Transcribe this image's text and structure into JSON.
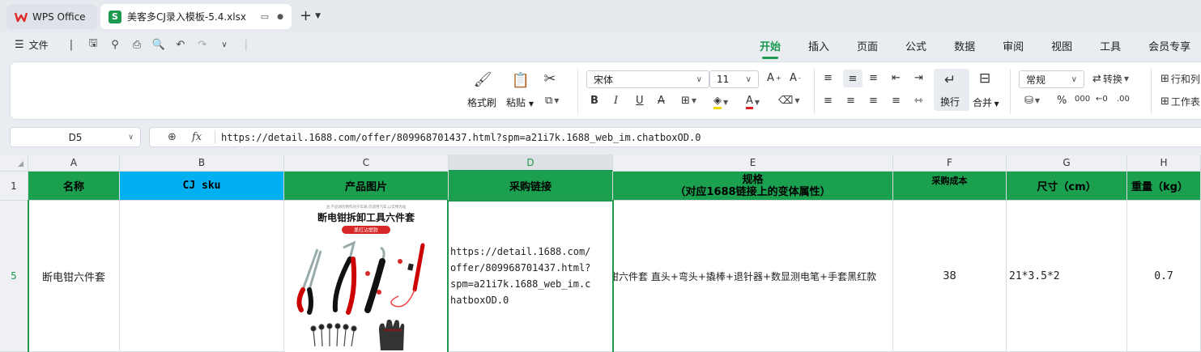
{
  "tabs": {
    "home": "WPS Office",
    "file": "美客多CJ录入模板-5.4.xlsx",
    "file_badge": "S"
  },
  "menu": {
    "file_label": "文件",
    "ribbon_tabs": [
      "开始",
      "插入",
      "页面",
      "公式",
      "数据",
      "审阅",
      "视图",
      "工具",
      "会员专享"
    ]
  },
  "ribbon": {
    "format_painter": "格式刷",
    "paste": "粘贴",
    "font_name": "宋体",
    "font_size": "11",
    "wrap": "换行",
    "merge": "合并",
    "number_format": "常规",
    "convert": "转换",
    "rows_cols": "行和列",
    "worksheet": "工作表"
  },
  "formula_bar": {
    "cell_ref": "D5",
    "fx": "fx",
    "content": "https://detail.1688.com/offer/809968701437.html?spm=a21i7k.1688_web_im.chatboxOD.0"
  },
  "grid": {
    "columns": [
      "A",
      "B",
      "C",
      "D",
      "E",
      "F",
      "G",
      "H"
    ],
    "rows": [
      "1",
      "5"
    ],
    "header_row": [
      "名称",
      "CJ sku",
      "产品图片",
      "采购链接",
      "规格",
      "采购成本",
      "尺寸（cm）",
      "重量（kg）"
    ],
    "spec_sub": "（对应1688链接上的变体属性）",
    "data_row": {
      "name": "断电钳六件套",
      "sku": "",
      "link": "https://detail.1688.com/\noffer/809968701437.html?\nspm=a21i7k.1688_web_im.c\nhatboxOD.0",
      "spec": "钳六件套 直头+弯头+撬棒+退针器+数显测电笔+手套黑红款",
      "cost": "38",
      "size": "21*3.5*2",
      "weight": "0.7"
    }
  },
  "product_image": {
    "tagline": "注:产品请勿用作对于车辆.仅适用汽车,以实物为准",
    "title": "断电钳拆卸工具六件套",
    "badge": "黑红沾塑款"
  },
  "colors": {
    "accent": "#1d9a4f",
    "header_green": "#1aa04f",
    "header_blue": "#00b0f0"
  }
}
